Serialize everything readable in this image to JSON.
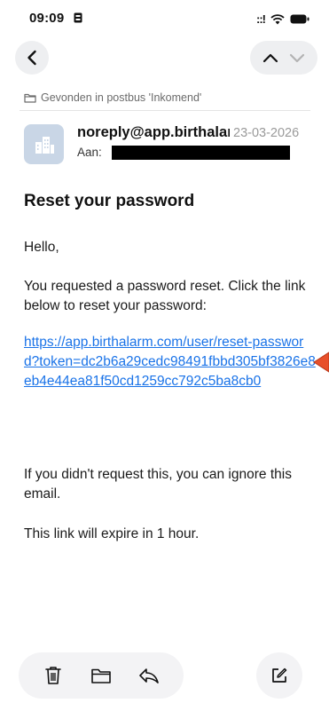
{
  "status_bar": {
    "time": "09:09",
    "signal": "::!"
  },
  "mail": {
    "found_in": "Gevonden in postbus 'Inkomend'",
    "sender": "noreply@app.birthalarm.com",
    "date": "23-03-2026",
    "to_label": "Aan:",
    "subject": "Reset your password",
    "greeting": "Hello,",
    "request_text": "You requested a password reset. Click the link below to reset your password:",
    "reset_link": "https://app.birthalarm.com/user/reset-password?token=dc2b6a29cedc98491fbbd305bf3826e8eb4e44ea81f50cd1259cc792c5ba8cb0",
    "ignore_text": "If you didn't request this, you can ignore this email.",
    "expire_text": "This link will expire in 1 hour."
  },
  "icons": {
    "back": "chevron-left-icon",
    "previous": "chevron-up-icon",
    "next": "chevron-down-icon",
    "folder": "folder-icon",
    "trash": "trash-icon",
    "move": "folder-icon",
    "reply": "reply-icon",
    "compose": "compose-icon"
  },
  "colors": {
    "link": "#1a73e8",
    "annotation_arrow": "#e8502a",
    "avatar_bg": "#c9d6e6"
  }
}
